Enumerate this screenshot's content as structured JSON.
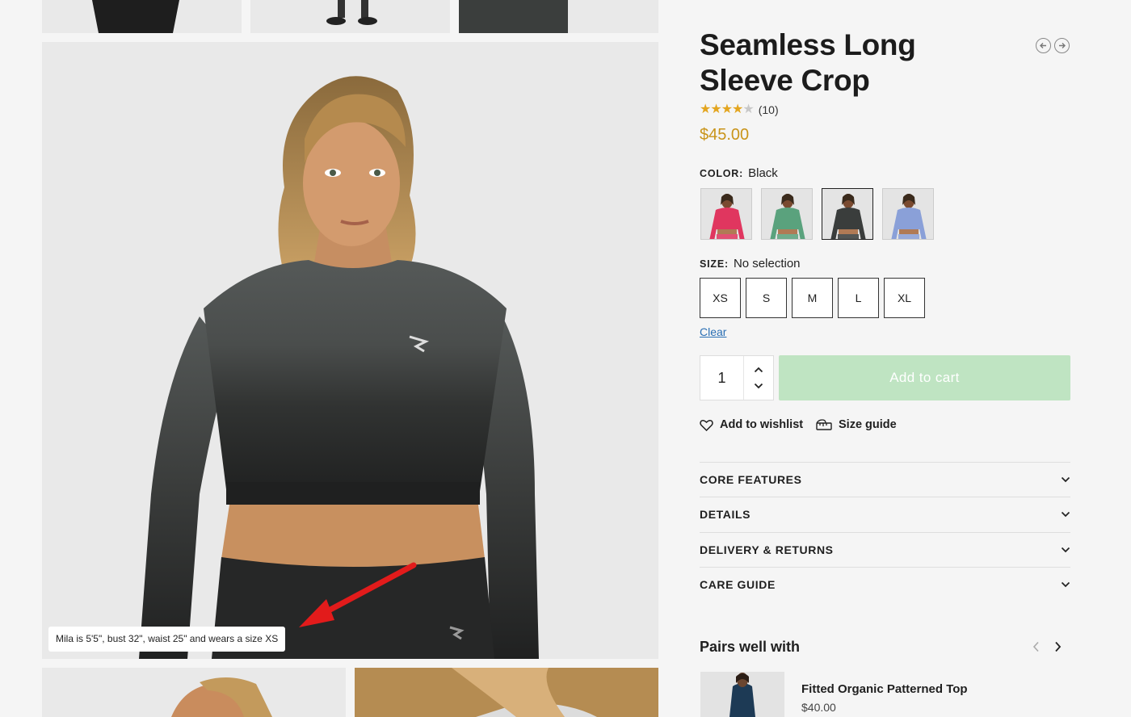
{
  "product": {
    "title": "Seamless Long Sleeve Crop",
    "rating_value": 4,
    "rating_max": 5,
    "review_count": "(10)",
    "price": "$45.00"
  },
  "gallery": {
    "caption": "Mila is 5'5\", bust 32\", waist 25\" and wears a size XS"
  },
  "color": {
    "label": "COLOR:",
    "selected": "Black",
    "swatches": [
      {
        "name": "pink",
        "shirt_color": "#e0365f"
      },
      {
        "name": "green",
        "shirt_color": "#5aa27d"
      },
      {
        "name": "black",
        "shirt_color": "#3a3d3c"
      },
      {
        "name": "blue-pink",
        "shirt_color": "#8aa0d8"
      }
    ]
  },
  "size": {
    "label": "SIZE:",
    "selected": "No selection",
    "options": [
      "XS",
      "S",
      "M",
      "L",
      "XL"
    ],
    "clear_label": "Clear"
  },
  "quantity": "1",
  "add_to_cart_label": "Add to cart",
  "wishlist_label": "Add to wishlist",
  "size_guide_label": "Size guide",
  "accordion": [
    "CORE FEATURES",
    "DETAILS",
    "DELIVERY & RETURNS",
    "CARE GUIDE"
  ],
  "pairs": {
    "title": "Pairs well with",
    "item_name": "Fitted Organic Patterned Top",
    "item_price": "$40.00"
  },
  "colors": {
    "price": "#c9941a",
    "star": "#e3a51f",
    "add_to_cart_disabled": "#bfe4c2",
    "link": "#2a6fb4"
  }
}
